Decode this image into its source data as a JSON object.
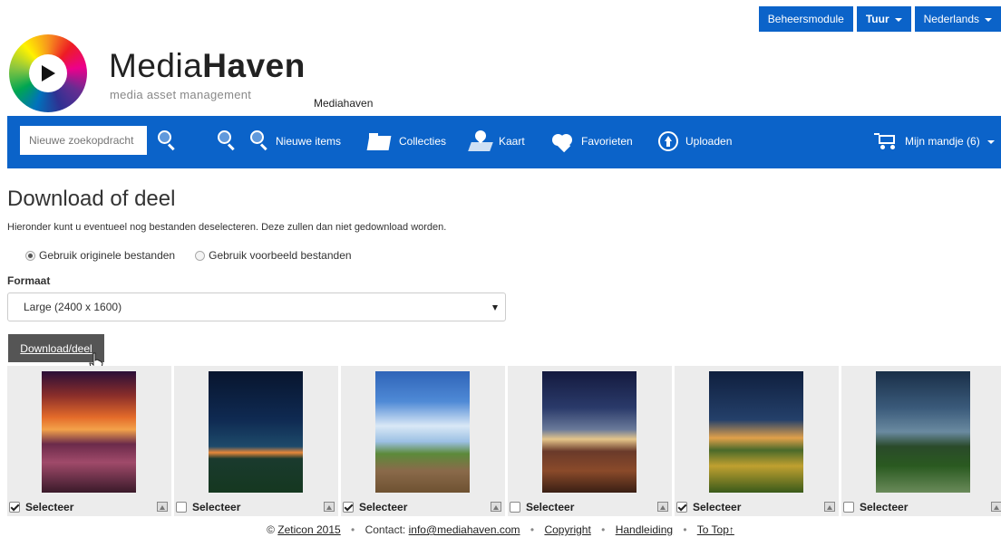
{
  "topbar": {
    "admin_label": "Beheersmodule",
    "user_label": "Tuur",
    "language_label": "Nederlands"
  },
  "logo": {
    "brand_light": "Media",
    "brand_bold": "Haven",
    "tagline": "media asset management",
    "tenant": "Mediahaven"
  },
  "nav": {
    "search_placeholder": "Nieuwe zoekopdracht",
    "new_items": "Nieuwe items",
    "collections": "Collecties",
    "map": "Kaart",
    "favorites": "Favorieten",
    "upload": "Uploaden",
    "cart": "Mijn mandje (6)"
  },
  "content": {
    "title": "Download of deel",
    "instruction": "Hieronder kunt u eventueel nog bestanden deselecteren. Deze zullen dan niet gedownload worden.",
    "radio_original": "Gebruik originele bestanden",
    "radio_preview": "Gebruik voorbeeld bestanden",
    "format_label": "Formaat",
    "format_selected": "Large (2400 x 1600)",
    "download_button": "Download/deel"
  },
  "gallery": {
    "items": [
      {
        "label": "Selecteer",
        "checked": true
      },
      {
        "label": "Selecteer",
        "checked": false
      },
      {
        "label": "Selecteer",
        "checked": true
      },
      {
        "label": "Selecteer",
        "checked": false
      },
      {
        "label": "Selecteer",
        "checked": true
      },
      {
        "label": "Selecteer",
        "checked": false
      }
    ]
  },
  "footer": {
    "copyright_symbol": "©",
    "company": "Zeticon 2015",
    "contact_label": "Contact:",
    "email": "info@mediahaven.com",
    "copyright_link": "Copyright",
    "manual": "Handleiding",
    "to_top": "To Top↑"
  },
  "colors": {
    "brand_blue": "#0b63c9",
    "button_gray": "#555555"
  }
}
